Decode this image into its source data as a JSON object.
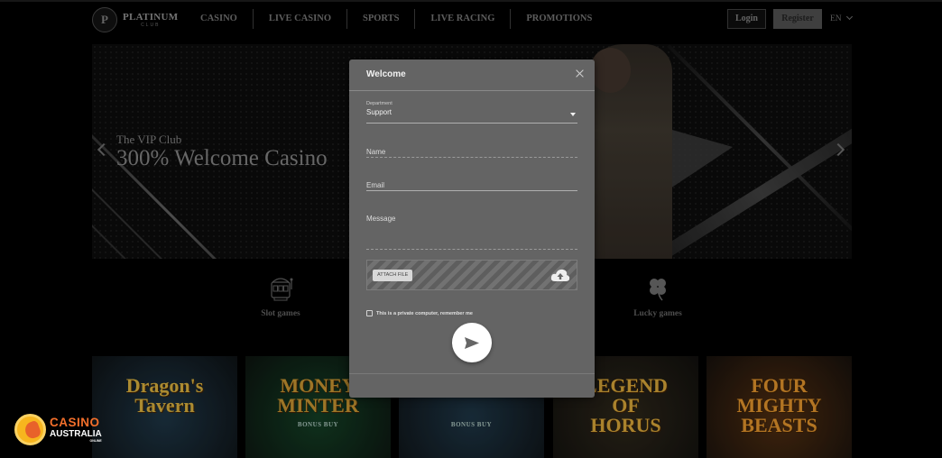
{
  "header": {
    "logo": {
      "badge": "P",
      "title": "PLATINUM",
      "subtitle": "CLUB"
    },
    "nav": [
      {
        "label": "CASINO"
      },
      {
        "label": "LIVE CASINO"
      },
      {
        "label": "SPORTS"
      },
      {
        "label": "LIVE RACING"
      },
      {
        "label": "PROMOTIONS"
      }
    ],
    "login_label": "Login",
    "register_label": "Register",
    "language": "EN"
  },
  "hero": {
    "subtitle": "The VIP Club",
    "title": "300% Welcome Casino"
  },
  "categories": [
    {
      "label": "Slot games",
      "icon": "slot-machine-icon"
    },
    {
      "label": "Lucky games",
      "icon": "clover-icon"
    }
  ],
  "games": [
    {
      "title": "Dragon's\nTavern",
      "subtitle": "",
      "color": "#c9a43a",
      "bg": "#1b3140"
    },
    {
      "title": "MONEY\nMINTER",
      "subtitle": "BONUS BUY",
      "color": "#b98a2e",
      "bg": "#123a22"
    },
    {
      "title": "",
      "subtitle": "BONUS BUY",
      "color": "#c9a43a",
      "bg": "#1b3140"
    },
    {
      "title": "LEGEND\nOF\nHORUS",
      "subtitle": "",
      "color": "#c89a36",
      "bg": "#2a2418"
    },
    {
      "title": "FOUR\nMIGHTY\nBEASTS",
      "subtitle": "",
      "color": "#d38a2a",
      "bg": "#4a2a10"
    }
  ],
  "modal": {
    "title": "Welcome",
    "department": {
      "label": "Department",
      "value": "Support"
    },
    "name": {
      "placeholder": "Name"
    },
    "email": {
      "placeholder": "Email"
    },
    "message": {
      "placeholder": "Message"
    },
    "attach_label": "ATTACH FILE",
    "remember_label": "This is a private computer, remember me",
    "remember_checked": false
  },
  "watermark": {
    "line1": "CASINO",
    "line2": "AUSTRALIA",
    "line3": "ONLINE"
  }
}
